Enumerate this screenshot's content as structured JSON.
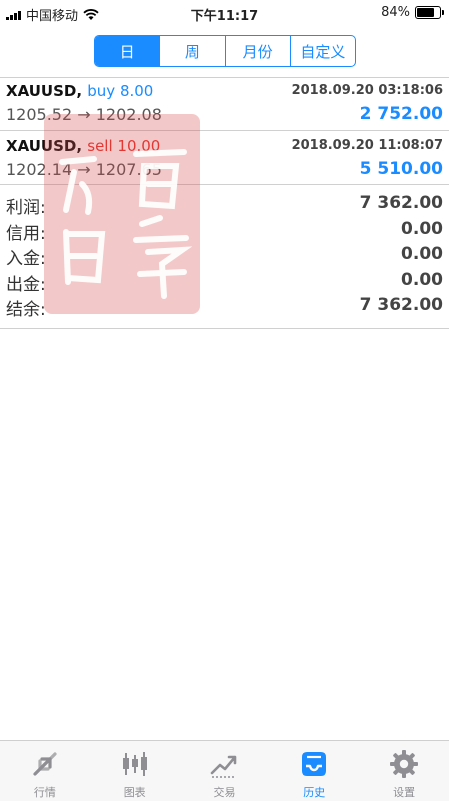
{
  "status_bar": {
    "carrier": "中国移动",
    "time": "下午11:17",
    "battery": "84%",
    "battery_level": 0.84
  },
  "tabs": [
    {
      "label": "日",
      "active": true
    },
    {
      "label": "周",
      "active": false
    },
    {
      "label": "月份",
      "active": false
    },
    {
      "label": "自定义",
      "active": false
    }
  ],
  "trades": [
    {
      "symbol": "XAUUSD,",
      "action": "buy 8.00",
      "action_color": "#1a8cff",
      "datetime": "2018.09.20 03:18:06",
      "prices": "1205.52 → 1202.08",
      "profit": "2 752.00"
    },
    {
      "symbol": "XAUUSD,",
      "action": "sell 10.00",
      "action_color": "#e8302c",
      "datetime": "2018.09.20 11:08:07",
      "prices": "1202.14 → 1207.65",
      "profit": "5 510.00"
    }
  ],
  "summary": [
    {
      "label": "利润:",
      "value": "7 362.00"
    },
    {
      "label": "信用:",
      "value": "0.00"
    },
    {
      "label": "入金:",
      "value": "0.00"
    },
    {
      "label": "出金:",
      "value": "0.00"
    },
    {
      "label": "结余:",
      "value": "7 362.00"
    }
  ],
  "bottom_tabs": [
    {
      "label": "行情",
      "icon": "quotes-arrows-icon",
      "active": false
    },
    {
      "label": "图表",
      "icon": "candlestick-chart-icon",
      "active": false
    },
    {
      "label": "交易",
      "icon": "trade-line-icon",
      "active": false
    },
    {
      "label": "历史",
      "icon": "history-inbox-icon",
      "active": true
    },
    {
      "label": "设置",
      "icon": "gear-icon",
      "active": false
    }
  ],
  "colors": {
    "accent": "#1a8cff",
    "sell": "#e8302c",
    "stamp": "#d64848"
  }
}
